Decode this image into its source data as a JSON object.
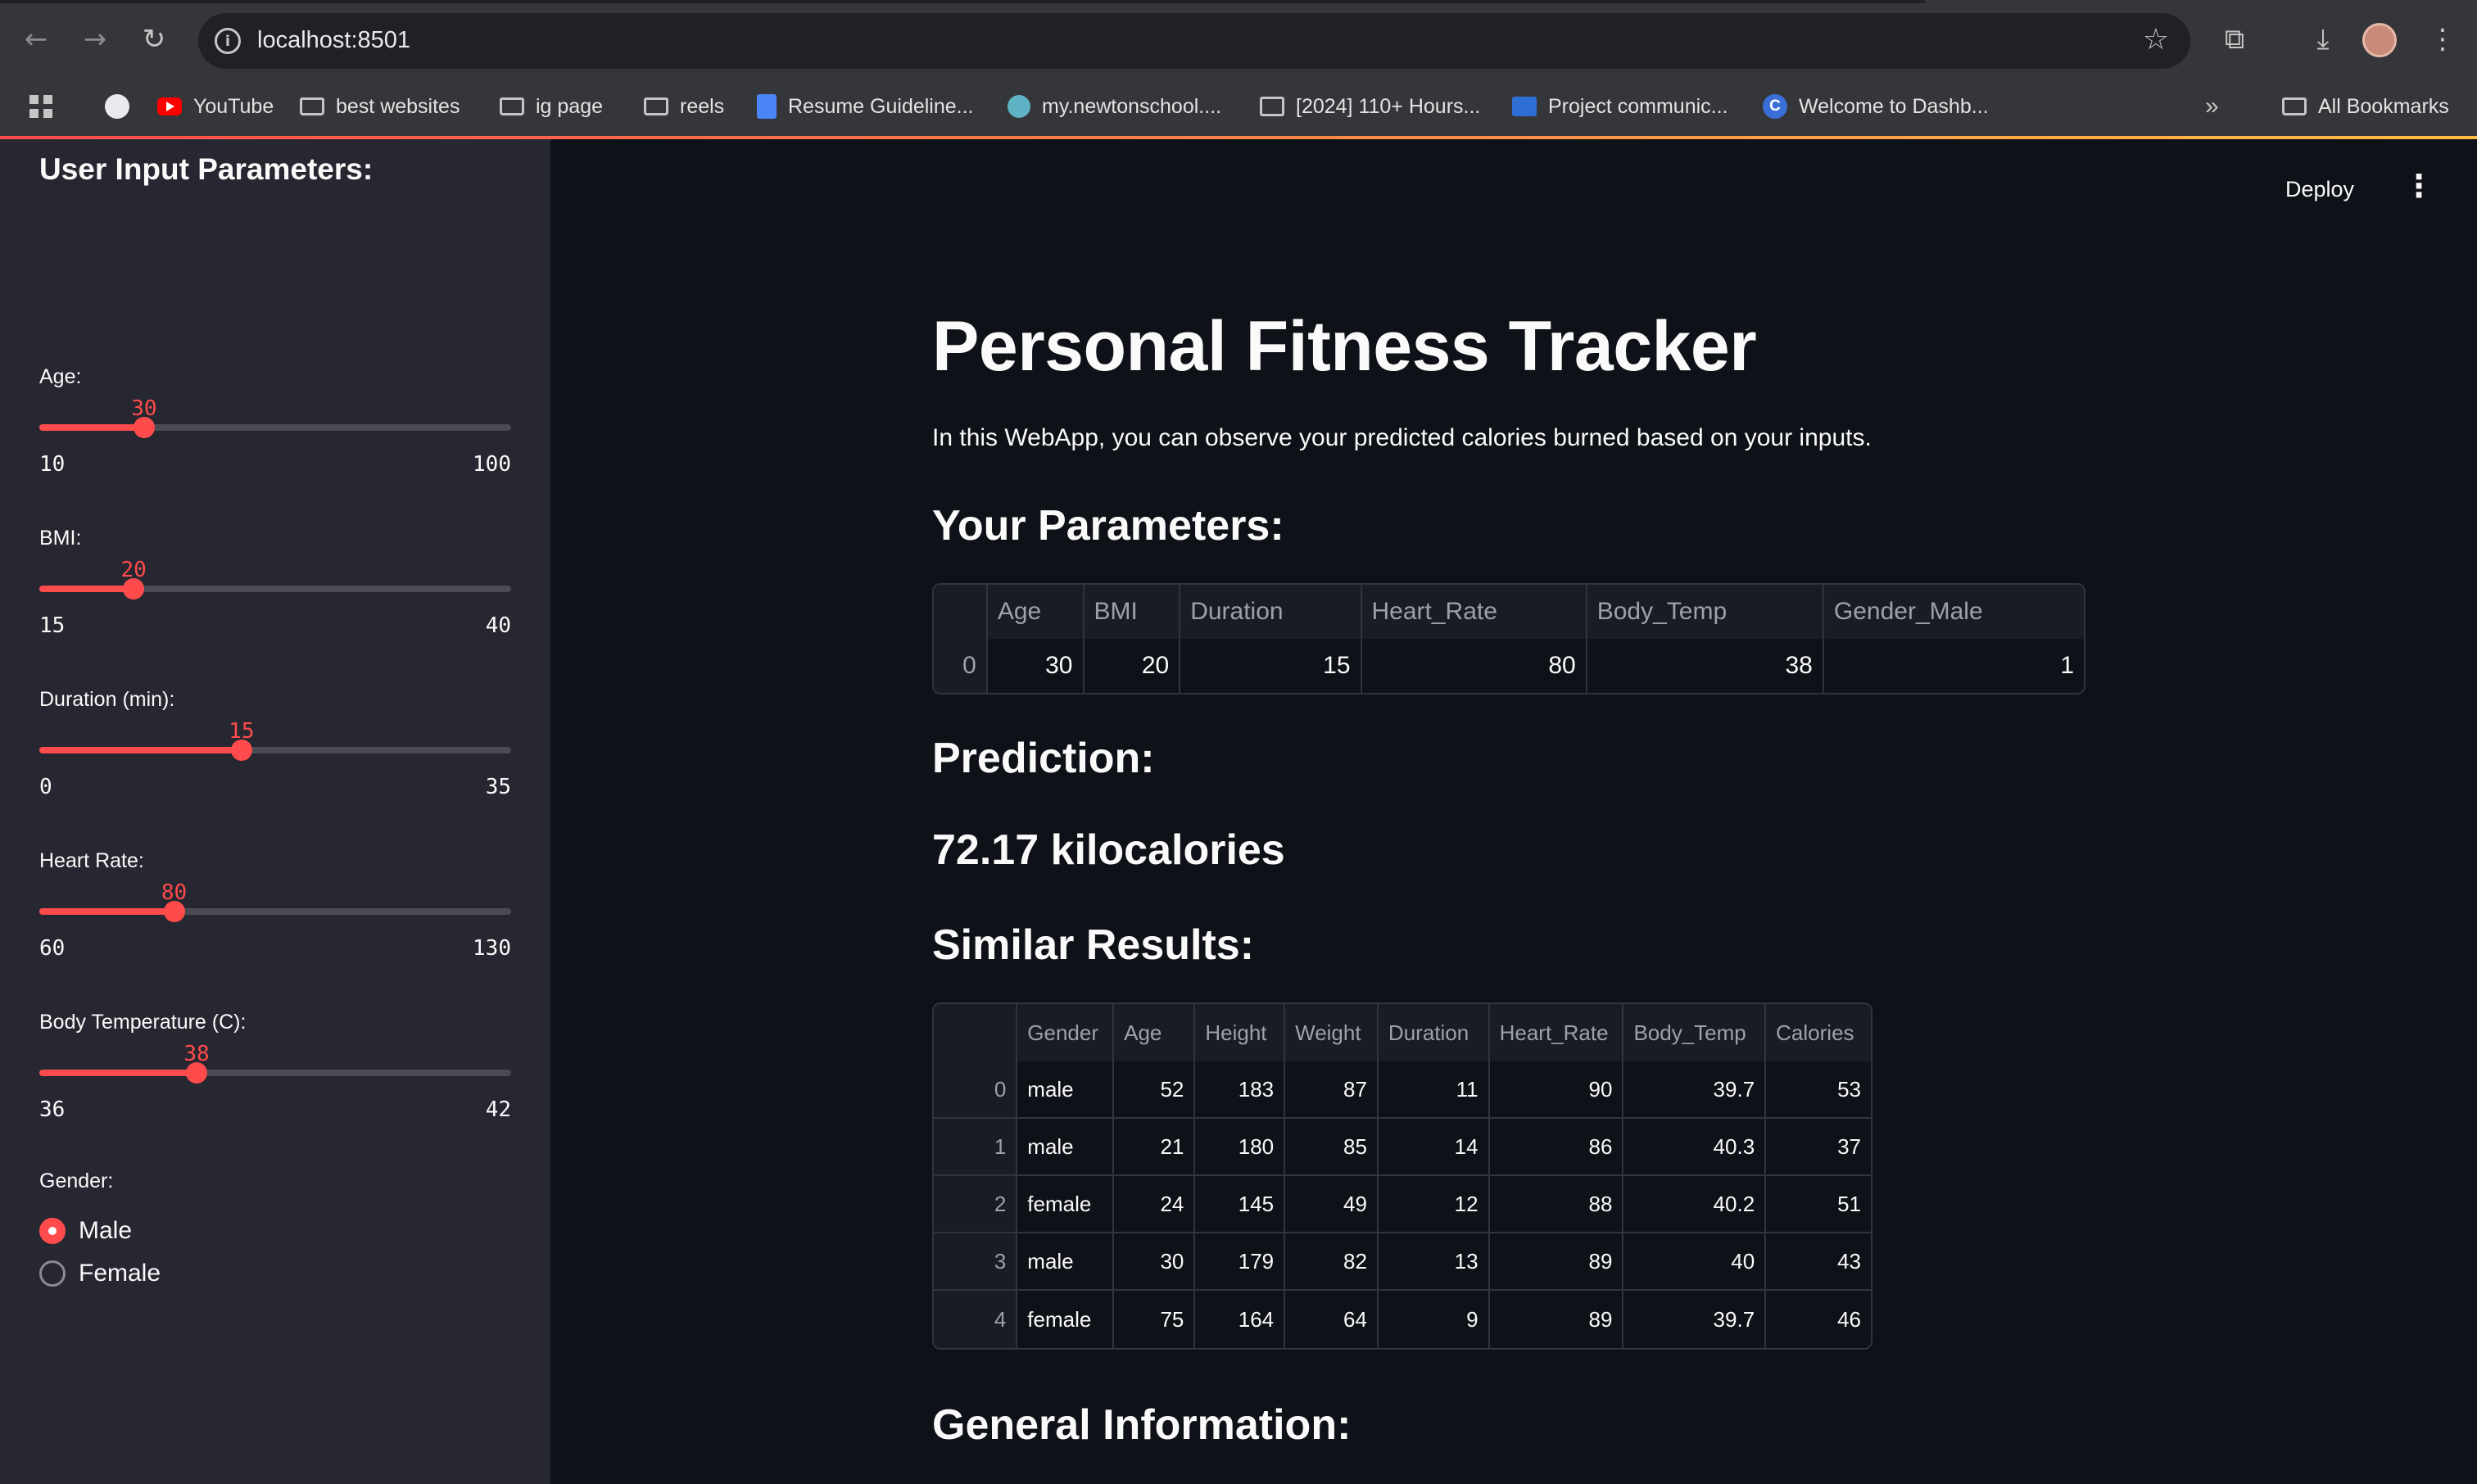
{
  "browser": {
    "url": "localhost:8501",
    "bookmarks": [
      {
        "label": "YouTube",
        "icon": "youtube-icon"
      },
      {
        "label": "best websites",
        "icon": "folder-icon"
      },
      {
        "label": "ig page",
        "icon": "folder-icon"
      },
      {
        "label": "reels",
        "icon": "folder-icon"
      },
      {
        "label": "Resume Guideline...",
        "icon": "docs-icon"
      },
      {
        "label": "my.newtonschool....",
        "icon": "newton-icon"
      },
      {
        "label": "[2024] 110+ Hours...",
        "icon": "cc-icon"
      },
      {
        "label": "Project communic...",
        "icon": "video-icon"
      },
      {
        "label": "Welcome to Dashb...",
        "icon": "c-icon"
      }
    ],
    "all_bookmarks": "All Bookmarks",
    "overflow": "»"
  },
  "sidebar": {
    "title": "User Input Parameters:",
    "sliders": [
      {
        "label": "Age:",
        "value": "30",
        "min": "10",
        "max": "100",
        "fraction": 0.222
      },
      {
        "label": "BMI:",
        "value": "20",
        "min": "15",
        "max": "40",
        "fraction": 0.2
      },
      {
        "label": "Duration (min):",
        "value": "15",
        "min": "0",
        "max": "35",
        "fraction": 0.4286
      },
      {
        "label": "Heart Rate:",
        "value": "80",
        "min": "60",
        "max": "130",
        "fraction": 0.2857
      },
      {
        "label": "Body Temperature (C):",
        "value": "38",
        "min": "36",
        "max": "42",
        "fraction": 0.3333
      }
    ],
    "gender": {
      "label": "Gender:",
      "options": [
        "Male",
        "Female"
      ],
      "selected": "Male"
    }
  },
  "toolbar": {
    "deploy": "Deploy",
    "menu": "⋮"
  },
  "main": {
    "title": "Personal Fitness Tracker",
    "intro": "In this WebApp, you can observe your predicted calories burned based on your inputs.",
    "params_heading": "Your Parameters:",
    "params_table": {
      "columns": [
        "",
        "Age",
        "BMI",
        "Duration",
        "Heart_Rate",
        "Body_Temp",
        "Gender_Male"
      ],
      "rows": [
        [
          "0",
          "30",
          "20",
          "15",
          "80",
          "38",
          "1"
        ]
      ]
    },
    "prediction_heading": "Prediction:",
    "prediction_value": "72.17 kilocalories",
    "similar_heading": "Similar Results:",
    "similar_table": {
      "columns": [
        "",
        "Gender",
        "Age",
        "Height",
        "Weight",
        "Duration",
        "Heart_Rate",
        "Body_Temp",
        "Calories"
      ],
      "rows": [
        [
          "0",
          "male",
          "52",
          "183",
          "87",
          "11",
          "90",
          "39.7",
          "53"
        ],
        [
          "1",
          "male",
          "21",
          "180",
          "85",
          "14",
          "86",
          "40.3",
          "37"
        ],
        [
          "2",
          "female",
          "24",
          "145",
          "49",
          "12",
          "88",
          "40.2",
          "51"
        ],
        [
          "3",
          "male",
          "30",
          "179",
          "82",
          "13",
          "89",
          "40",
          "43"
        ],
        [
          "4",
          "female",
          "75",
          "164",
          "64",
          "9",
          "89",
          "39.7",
          "46"
        ]
      ]
    },
    "general_heading": "General Information:"
  },
  "colors": {
    "accent": "#ff4b4b",
    "sidebar_bg": "#262730",
    "main_bg": "#0e1117"
  }
}
